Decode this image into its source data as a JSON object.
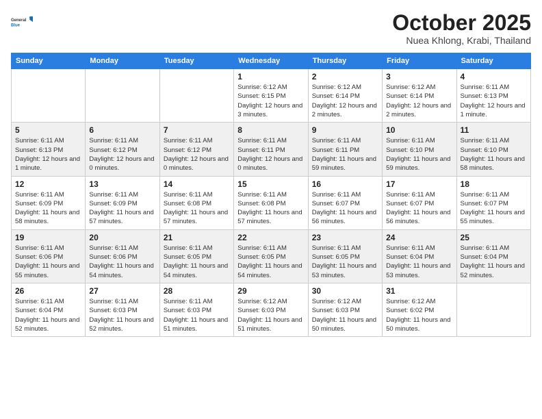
{
  "header": {
    "logo_line1": "General",
    "logo_line2": "Blue",
    "month_title": "October 2025",
    "location": "Nuea Khlong, Krabi, Thailand"
  },
  "weekdays": [
    "Sunday",
    "Monday",
    "Tuesday",
    "Wednesday",
    "Thursday",
    "Friday",
    "Saturday"
  ],
  "weeks": [
    [
      {
        "day": "",
        "info": ""
      },
      {
        "day": "",
        "info": ""
      },
      {
        "day": "",
        "info": ""
      },
      {
        "day": "1",
        "info": "Sunrise: 6:12 AM\nSunset: 6:15 PM\nDaylight: 12 hours and 3 minutes."
      },
      {
        "day": "2",
        "info": "Sunrise: 6:12 AM\nSunset: 6:14 PM\nDaylight: 12 hours and 2 minutes."
      },
      {
        "day": "3",
        "info": "Sunrise: 6:12 AM\nSunset: 6:14 PM\nDaylight: 12 hours and 2 minutes."
      },
      {
        "day": "4",
        "info": "Sunrise: 6:11 AM\nSunset: 6:13 PM\nDaylight: 12 hours and 1 minute."
      }
    ],
    [
      {
        "day": "5",
        "info": "Sunrise: 6:11 AM\nSunset: 6:13 PM\nDaylight: 12 hours and 1 minute."
      },
      {
        "day": "6",
        "info": "Sunrise: 6:11 AM\nSunset: 6:12 PM\nDaylight: 12 hours and 0 minutes."
      },
      {
        "day": "7",
        "info": "Sunrise: 6:11 AM\nSunset: 6:12 PM\nDaylight: 12 hours and 0 minutes."
      },
      {
        "day": "8",
        "info": "Sunrise: 6:11 AM\nSunset: 6:11 PM\nDaylight: 12 hours and 0 minutes."
      },
      {
        "day": "9",
        "info": "Sunrise: 6:11 AM\nSunset: 6:11 PM\nDaylight: 11 hours and 59 minutes."
      },
      {
        "day": "10",
        "info": "Sunrise: 6:11 AM\nSunset: 6:10 PM\nDaylight: 11 hours and 59 minutes."
      },
      {
        "day": "11",
        "info": "Sunrise: 6:11 AM\nSunset: 6:10 PM\nDaylight: 11 hours and 58 minutes."
      }
    ],
    [
      {
        "day": "12",
        "info": "Sunrise: 6:11 AM\nSunset: 6:09 PM\nDaylight: 11 hours and 58 minutes."
      },
      {
        "day": "13",
        "info": "Sunrise: 6:11 AM\nSunset: 6:09 PM\nDaylight: 11 hours and 57 minutes."
      },
      {
        "day": "14",
        "info": "Sunrise: 6:11 AM\nSunset: 6:08 PM\nDaylight: 11 hours and 57 minutes."
      },
      {
        "day": "15",
        "info": "Sunrise: 6:11 AM\nSunset: 6:08 PM\nDaylight: 11 hours and 57 minutes."
      },
      {
        "day": "16",
        "info": "Sunrise: 6:11 AM\nSunset: 6:07 PM\nDaylight: 11 hours and 56 minutes."
      },
      {
        "day": "17",
        "info": "Sunrise: 6:11 AM\nSunset: 6:07 PM\nDaylight: 11 hours and 56 minutes."
      },
      {
        "day": "18",
        "info": "Sunrise: 6:11 AM\nSunset: 6:07 PM\nDaylight: 11 hours and 55 minutes."
      }
    ],
    [
      {
        "day": "19",
        "info": "Sunrise: 6:11 AM\nSunset: 6:06 PM\nDaylight: 11 hours and 55 minutes."
      },
      {
        "day": "20",
        "info": "Sunrise: 6:11 AM\nSunset: 6:06 PM\nDaylight: 11 hours and 54 minutes."
      },
      {
        "day": "21",
        "info": "Sunrise: 6:11 AM\nSunset: 6:05 PM\nDaylight: 11 hours and 54 minutes."
      },
      {
        "day": "22",
        "info": "Sunrise: 6:11 AM\nSunset: 6:05 PM\nDaylight: 11 hours and 54 minutes."
      },
      {
        "day": "23",
        "info": "Sunrise: 6:11 AM\nSunset: 6:05 PM\nDaylight: 11 hours and 53 minutes."
      },
      {
        "day": "24",
        "info": "Sunrise: 6:11 AM\nSunset: 6:04 PM\nDaylight: 11 hours and 53 minutes."
      },
      {
        "day": "25",
        "info": "Sunrise: 6:11 AM\nSunset: 6:04 PM\nDaylight: 11 hours and 52 minutes."
      }
    ],
    [
      {
        "day": "26",
        "info": "Sunrise: 6:11 AM\nSunset: 6:04 PM\nDaylight: 11 hours and 52 minutes."
      },
      {
        "day": "27",
        "info": "Sunrise: 6:11 AM\nSunset: 6:03 PM\nDaylight: 11 hours and 52 minutes."
      },
      {
        "day": "28",
        "info": "Sunrise: 6:11 AM\nSunset: 6:03 PM\nDaylight: 11 hours and 51 minutes."
      },
      {
        "day": "29",
        "info": "Sunrise: 6:12 AM\nSunset: 6:03 PM\nDaylight: 11 hours and 51 minutes."
      },
      {
        "day": "30",
        "info": "Sunrise: 6:12 AM\nSunset: 6:03 PM\nDaylight: 11 hours and 50 minutes."
      },
      {
        "day": "31",
        "info": "Sunrise: 6:12 AM\nSunset: 6:02 PM\nDaylight: 11 hours and 50 minutes."
      },
      {
        "day": "",
        "info": ""
      }
    ]
  ]
}
